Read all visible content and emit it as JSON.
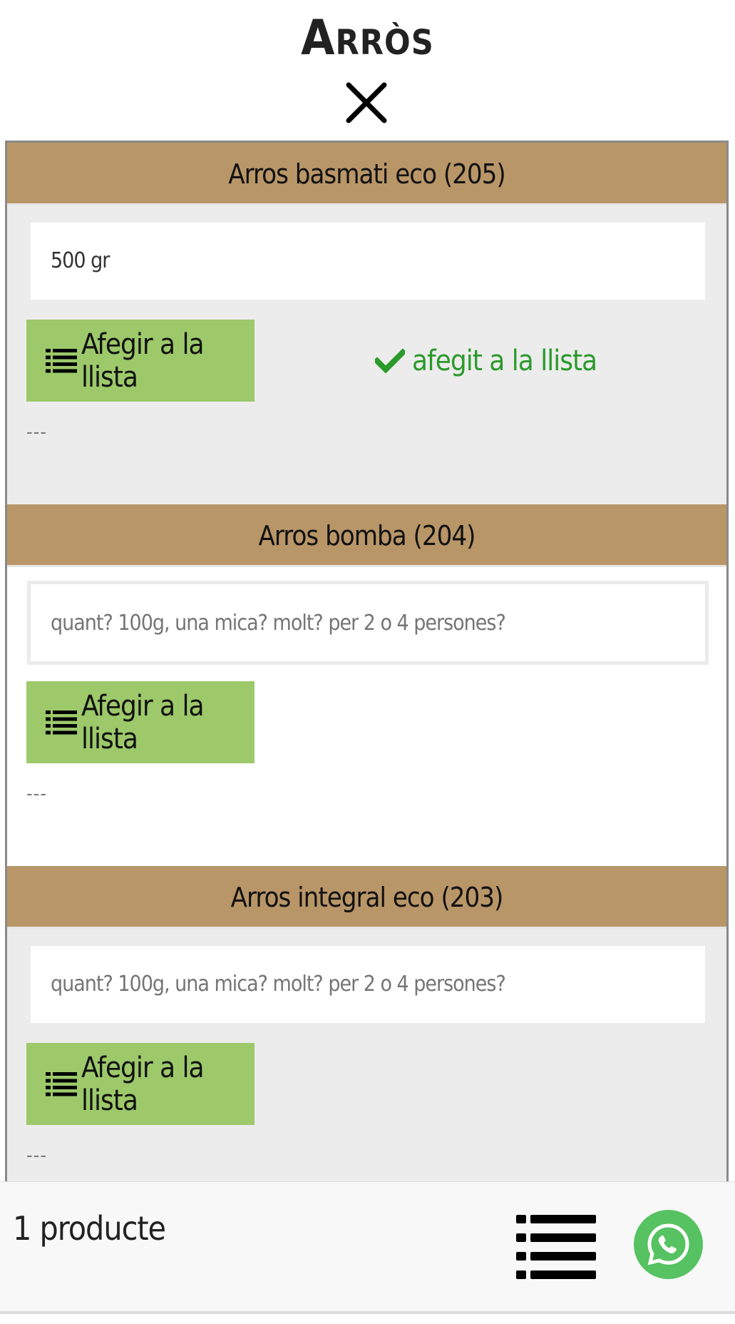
{
  "header": {
    "title": "Arròs",
    "close_icon": "close-icon"
  },
  "products": [
    {
      "name": "Arros basmati eco (205)",
      "quantity_value": "500 gr",
      "quantity_placeholder": "quant? 100g, una mica? molt? per 2 o 4 persones?",
      "add_label": "Afegir a la llista",
      "added_label": "afegit a la llista",
      "notes": "---"
    },
    {
      "name": "Arros bomba (204)",
      "quantity_value": "",
      "quantity_placeholder": "quant? 100g, una mica? molt? per 2 o 4 persones?",
      "add_label": "Afegir a la llista",
      "notes": "---"
    },
    {
      "name": "Arros integral eco (203)",
      "quantity_value": "",
      "quantity_placeholder": "quant? 100g, una mica? molt? per 2 o 4 persones?",
      "add_label": "Afegir a la llista",
      "notes": "---"
    }
  ],
  "footer": {
    "product_count": "1 producte",
    "list_icon": "list-icon",
    "whatsapp_icon": "whatsapp-icon"
  },
  "colors": {
    "product_header_bg": "#b99668",
    "add_button_bg": "#9dc96a",
    "added_text": "#2a9a2a",
    "whatsapp_green": "#56c261"
  }
}
